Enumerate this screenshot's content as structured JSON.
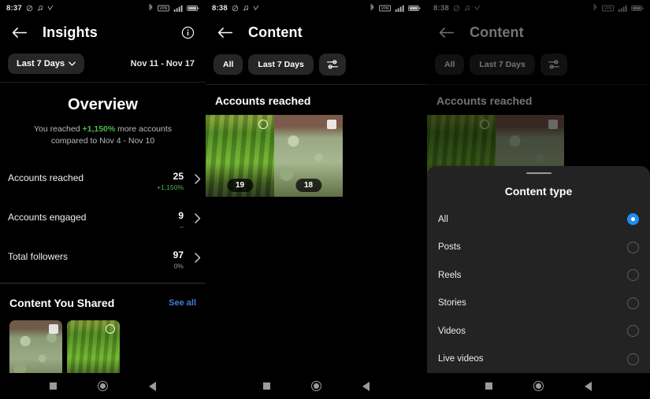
{
  "panel1": {
    "status": {
      "time": "8:37",
      "icons": [
        "mute-icon",
        "music-note-icon",
        "checkmark-icon"
      ],
      "right_icons": [
        "bluetooth-icon",
        "vpn-icon",
        "signal-icon",
        "battery-icon"
      ]
    },
    "appbar": {
      "back": "back-arrow-icon",
      "title": "Insights",
      "info": "info-icon"
    },
    "filter": {
      "chip_label": "Last 7 Days",
      "chevron": "chevron-down-icon",
      "date_range": "Nov 11 - Nov 17"
    },
    "overview": {
      "title": "Overview",
      "sub_prefix": "You reached ",
      "sub_highlight": "+1,150%",
      "sub_suffix": " more accounts",
      "sub_line2": "compared to Nov 4 - Nov 10"
    },
    "metrics": [
      {
        "label": "Accounts reached",
        "value": "25",
        "delta": "+1,150%",
        "trend": "up"
      },
      {
        "label": "Accounts engaged",
        "value": "9",
        "delta": "–",
        "trend": "flat"
      },
      {
        "label": "Total followers",
        "value": "97",
        "delta": "0%",
        "trend": "flat"
      }
    ],
    "shared": {
      "title": "Content You Shared",
      "see_all": "See all",
      "thumbs": [
        {
          "kind": "blue-spruce",
          "badge": "square"
        },
        {
          "kind": "green-cyp",
          "badge": "ring"
        }
      ]
    }
  },
  "panel2": {
    "status": {
      "time": "8:38"
    },
    "appbar": {
      "title": "Content"
    },
    "chips": [
      {
        "label": "All"
      },
      {
        "label": "Last 7 Days"
      }
    ],
    "filter_icon": "sliders-icon",
    "section_title": "Accounts reached",
    "media": [
      {
        "kind": "green-cyp",
        "count": "19",
        "badge": "ring"
      },
      {
        "kind": "spruce",
        "count": "18",
        "badge": "square"
      }
    ]
  },
  "panel3": {
    "status": {
      "time": "8:38"
    },
    "appbar": {
      "title": "Content"
    },
    "chips": [
      {
        "label": "All"
      },
      {
        "label": "Last 7 Days"
      }
    ],
    "filter_icon": "sliders-icon",
    "section_title": "Accounts reached",
    "media": [
      {
        "kind": "green-cyp",
        "count": "19",
        "badge": "ring"
      },
      {
        "kind": "spruce",
        "count": "18",
        "badge": "square"
      }
    ],
    "sheet": {
      "title": "Content type",
      "options": [
        {
          "label": "All",
          "selected": true
        },
        {
          "label": "Posts",
          "selected": false
        },
        {
          "label": "Reels",
          "selected": false
        },
        {
          "label": "Stories",
          "selected": false
        },
        {
          "label": "Videos",
          "selected": false
        },
        {
          "label": "Live videos",
          "selected": false
        }
      ]
    }
  },
  "navbar": {
    "recents": "square-icon",
    "home": "circle-icon",
    "back": "triangle-back-icon"
  },
  "colors": {
    "accent_blue": "#1d8ef0",
    "link_blue": "#3f7fd4",
    "positive_green": "#4db84d",
    "chip_bg": "#262626",
    "sheet_bg": "#232323"
  }
}
